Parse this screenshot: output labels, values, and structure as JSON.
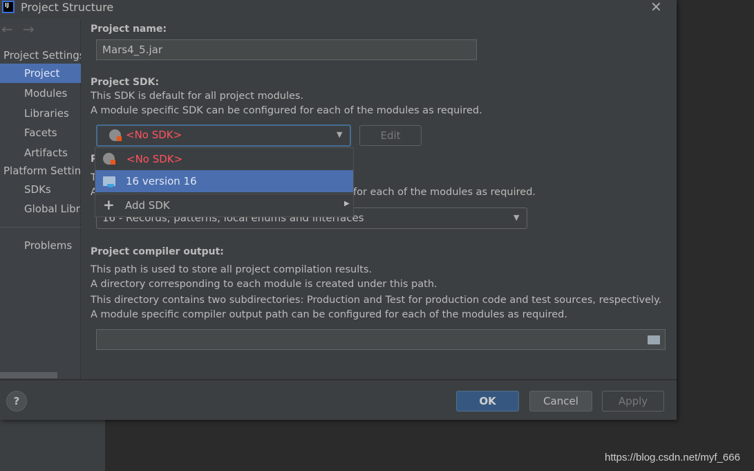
{
  "window": {
    "title": "Project Structure",
    "close_icon": "close-icon",
    "app_icon": "intellij-icon"
  },
  "nav": {
    "back": "←",
    "forward": "→"
  },
  "sidebar": {
    "project_settings": "Project Settings",
    "items": [
      {
        "label": "Project",
        "selected": true
      },
      {
        "label": "Modules"
      },
      {
        "label": "Libraries"
      },
      {
        "label": "Facets"
      },
      {
        "label": "Artifacts"
      }
    ],
    "platform_settings": "Platform Settings",
    "platform_items": [
      {
        "label": "SDKs"
      },
      {
        "label": "Global Libraries"
      }
    ],
    "problems": "Problems"
  },
  "project_name": {
    "label": "Project name:",
    "value": "Mars4_5.jar"
  },
  "project_sdk": {
    "label": "Project SDK:",
    "desc1": "This SDK is default for all project modules.",
    "desc2": "A module specific SDK can be configured for each of the modules as required.",
    "selected": "<No SDK>",
    "edit": "Edit",
    "no_sdk_color": "#ff5261"
  },
  "sdk_popup": {
    "items": [
      {
        "label": "<No SDK>",
        "icon": "globe-icon"
      },
      {
        "label": "16 version 16",
        "icon": "jdk-folder-icon",
        "highlighted": true
      },
      {
        "label": "Add SDK",
        "icon": "plus-icon",
        "submenu": true
      }
    ]
  },
  "language_level": {
    "label_fragment": "P",
    "desc1_fragment": "T",
    "desc2_fragment_start": "A",
    "desc2_fragment_end": "for each of the modules as required.",
    "selected": "16 - Records, patterns, local enums and interfaces"
  },
  "compiler_output": {
    "label": "Project compiler output:",
    "lines": [
      "This path is used to store all project compilation results.",
      "A directory corresponding to each module is created under this path.",
      "This directory contains two subdirectories: Production and Test for production code and test sources, respectively.",
      "A module specific compiler output path can be configured for each of the modules as required."
    ],
    "value": ""
  },
  "footer": {
    "help": "?",
    "ok": "OK",
    "cancel": "Cancel",
    "apply": "Apply"
  },
  "watermark": "https://blog.csdn.net/myf_666",
  "colors": {
    "accent": "#4b6eaf",
    "ok": "#365880"
  }
}
